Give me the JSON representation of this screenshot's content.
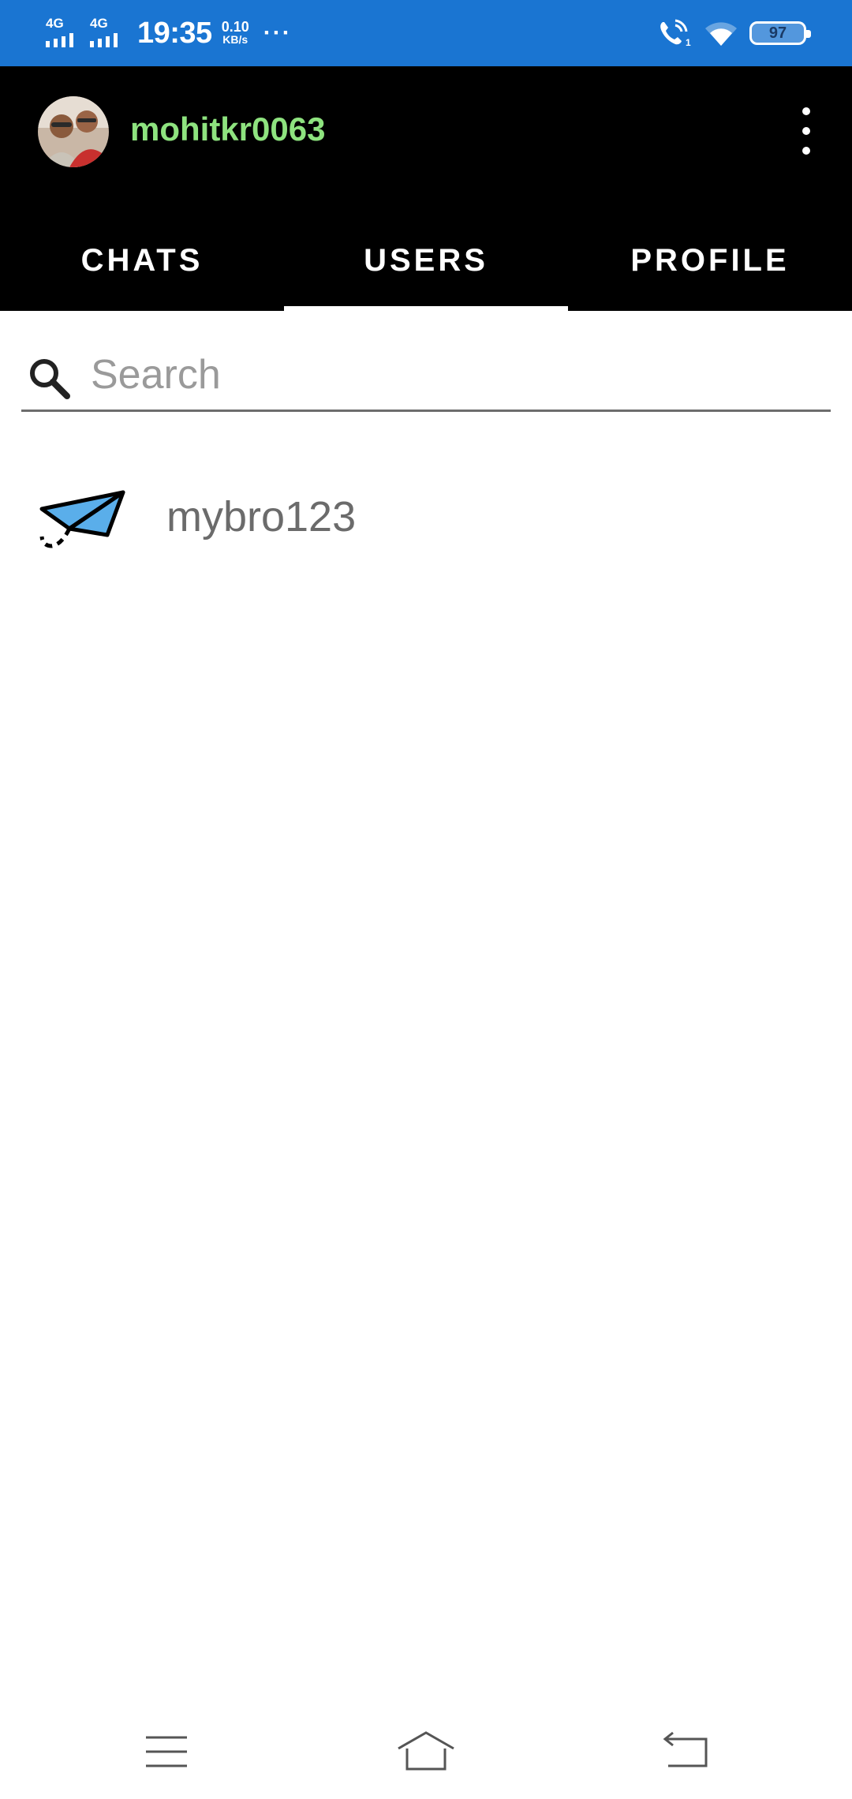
{
  "status_bar": {
    "network1": "4G",
    "network2": "4G",
    "time": "19:35",
    "speed_value": "0.10",
    "speed_unit": "KB/s",
    "more": "···",
    "battery": "97",
    "icons": [
      "signal-bars-icon",
      "signal-bars-icon",
      "wifi-calling-icon",
      "wifi-icon",
      "battery-icon"
    ]
  },
  "header": {
    "avatar_icon": "profile-photo",
    "username": "mohitkr0063",
    "menu_icon": "more-vertical-icon"
  },
  "tabs": [
    {
      "label": "CHATS",
      "active": false
    },
    {
      "label": "USERS",
      "active": true
    },
    {
      "label": "PROFILE",
      "active": false
    }
  ],
  "search": {
    "placeholder": "Search",
    "value": "",
    "icon": "search-icon"
  },
  "users": [
    {
      "name": "mybro123",
      "icon": "paper-plane-icon"
    }
  ],
  "nav": {
    "icons": [
      "menu-icon",
      "home-icon",
      "back-icon"
    ]
  },
  "colors": {
    "status_bar": "#1a75d2",
    "app_bar": "#000000",
    "username": "#8ee37f",
    "plane": "#5aaeea"
  }
}
